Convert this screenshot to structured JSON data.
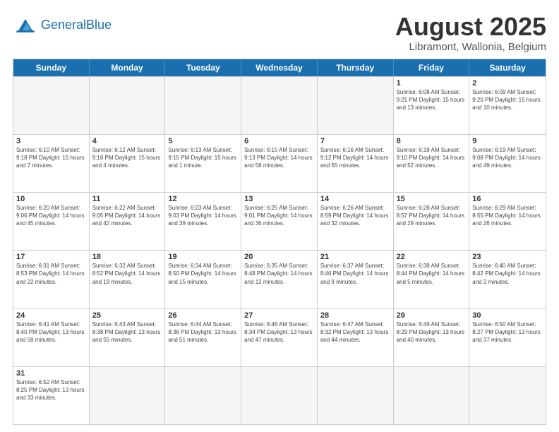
{
  "header": {
    "logo_general": "General",
    "logo_blue": "Blue",
    "title": "August 2025",
    "subtitle": "Libramont, Wallonia, Belgium"
  },
  "weekdays": [
    "Sunday",
    "Monday",
    "Tuesday",
    "Wednesday",
    "Thursday",
    "Friday",
    "Saturday"
  ],
  "rows": [
    [
      {
        "day": "",
        "info": "",
        "empty": true
      },
      {
        "day": "",
        "info": "",
        "empty": true
      },
      {
        "day": "",
        "info": "",
        "empty": true
      },
      {
        "day": "",
        "info": "",
        "empty": true
      },
      {
        "day": "",
        "info": "",
        "empty": true
      },
      {
        "day": "1",
        "info": "Sunrise: 6:08 AM\nSunset: 9:21 PM\nDaylight: 15 hours and 13 minutes."
      },
      {
        "day": "2",
        "info": "Sunrise: 6:09 AM\nSunset: 9:20 PM\nDaylight: 15 hours and 10 minutes."
      }
    ],
    [
      {
        "day": "3",
        "info": "Sunrise: 6:10 AM\nSunset: 9:18 PM\nDaylight: 15 hours and 7 minutes."
      },
      {
        "day": "4",
        "info": "Sunrise: 6:12 AM\nSunset: 9:16 PM\nDaylight: 15 hours and 4 minutes."
      },
      {
        "day": "5",
        "info": "Sunrise: 6:13 AM\nSunset: 9:15 PM\nDaylight: 15 hours and 1 minute."
      },
      {
        "day": "6",
        "info": "Sunrise: 6:15 AM\nSunset: 9:13 PM\nDaylight: 14 hours and 58 minutes."
      },
      {
        "day": "7",
        "info": "Sunrise: 6:16 AM\nSunset: 9:12 PM\nDaylight: 14 hours and 55 minutes."
      },
      {
        "day": "8",
        "info": "Sunrise: 6:18 AM\nSunset: 9:10 PM\nDaylight: 14 hours and 52 minutes."
      },
      {
        "day": "9",
        "info": "Sunrise: 6:19 AM\nSunset: 9:08 PM\nDaylight: 14 hours and 49 minutes."
      }
    ],
    [
      {
        "day": "10",
        "info": "Sunrise: 6:20 AM\nSunset: 9:06 PM\nDaylight: 14 hours and 45 minutes."
      },
      {
        "day": "11",
        "info": "Sunrise: 6:22 AM\nSunset: 9:05 PM\nDaylight: 14 hours and 42 minutes."
      },
      {
        "day": "12",
        "info": "Sunrise: 6:23 AM\nSunset: 9:03 PM\nDaylight: 14 hours and 39 minutes."
      },
      {
        "day": "13",
        "info": "Sunrise: 6:25 AM\nSunset: 9:01 PM\nDaylight: 14 hours and 36 minutes."
      },
      {
        "day": "14",
        "info": "Sunrise: 6:26 AM\nSunset: 8:59 PM\nDaylight: 14 hours and 32 minutes."
      },
      {
        "day": "15",
        "info": "Sunrise: 6:28 AM\nSunset: 8:57 PM\nDaylight: 14 hours and 29 minutes."
      },
      {
        "day": "16",
        "info": "Sunrise: 6:29 AM\nSunset: 8:55 PM\nDaylight: 14 hours and 26 minutes."
      }
    ],
    [
      {
        "day": "17",
        "info": "Sunrise: 6:31 AM\nSunset: 8:53 PM\nDaylight: 14 hours and 22 minutes."
      },
      {
        "day": "18",
        "info": "Sunrise: 6:32 AM\nSunset: 8:52 PM\nDaylight: 14 hours and 19 minutes."
      },
      {
        "day": "19",
        "info": "Sunrise: 6:34 AM\nSunset: 8:50 PM\nDaylight: 14 hours and 15 minutes."
      },
      {
        "day": "20",
        "info": "Sunrise: 6:35 AM\nSunset: 8:48 PM\nDaylight: 14 hours and 12 minutes."
      },
      {
        "day": "21",
        "info": "Sunrise: 6:37 AM\nSunset: 8:46 PM\nDaylight: 14 hours and 9 minutes."
      },
      {
        "day": "22",
        "info": "Sunrise: 6:38 AM\nSunset: 8:44 PM\nDaylight: 14 hours and 5 minutes."
      },
      {
        "day": "23",
        "info": "Sunrise: 6:40 AM\nSunset: 8:42 PM\nDaylight: 14 hours and 2 minutes."
      }
    ],
    [
      {
        "day": "24",
        "info": "Sunrise: 6:41 AM\nSunset: 8:40 PM\nDaylight: 13 hours and 58 minutes."
      },
      {
        "day": "25",
        "info": "Sunrise: 6:43 AM\nSunset: 8:38 PM\nDaylight: 13 hours and 55 minutes."
      },
      {
        "day": "26",
        "info": "Sunrise: 6:44 AM\nSunset: 8:36 PM\nDaylight: 13 hours and 51 minutes."
      },
      {
        "day": "27",
        "info": "Sunrise: 6:46 AM\nSunset: 8:34 PM\nDaylight: 13 hours and 47 minutes."
      },
      {
        "day": "28",
        "info": "Sunrise: 6:47 AM\nSunset: 8:32 PM\nDaylight: 13 hours and 44 minutes."
      },
      {
        "day": "29",
        "info": "Sunrise: 6:49 AM\nSunset: 8:29 PM\nDaylight: 13 hours and 40 minutes."
      },
      {
        "day": "30",
        "info": "Sunrise: 6:50 AM\nSunset: 8:27 PM\nDaylight: 13 hours and 37 minutes."
      }
    ],
    [
      {
        "day": "31",
        "info": "Sunrise: 6:52 AM\nSunset: 8:25 PM\nDaylight: 13 hours and 33 minutes."
      },
      {
        "day": "",
        "info": "",
        "empty": true
      },
      {
        "day": "",
        "info": "",
        "empty": true
      },
      {
        "day": "",
        "info": "",
        "empty": true
      },
      {
        "day": "",
        "info": "",
        "empty": true
      },
      {
        "day": "",
        "info": "",
        "empty": true
      },
      {
        "day": "",
        "info": "",
        "empty": true
      }
    ]
  ]
}
